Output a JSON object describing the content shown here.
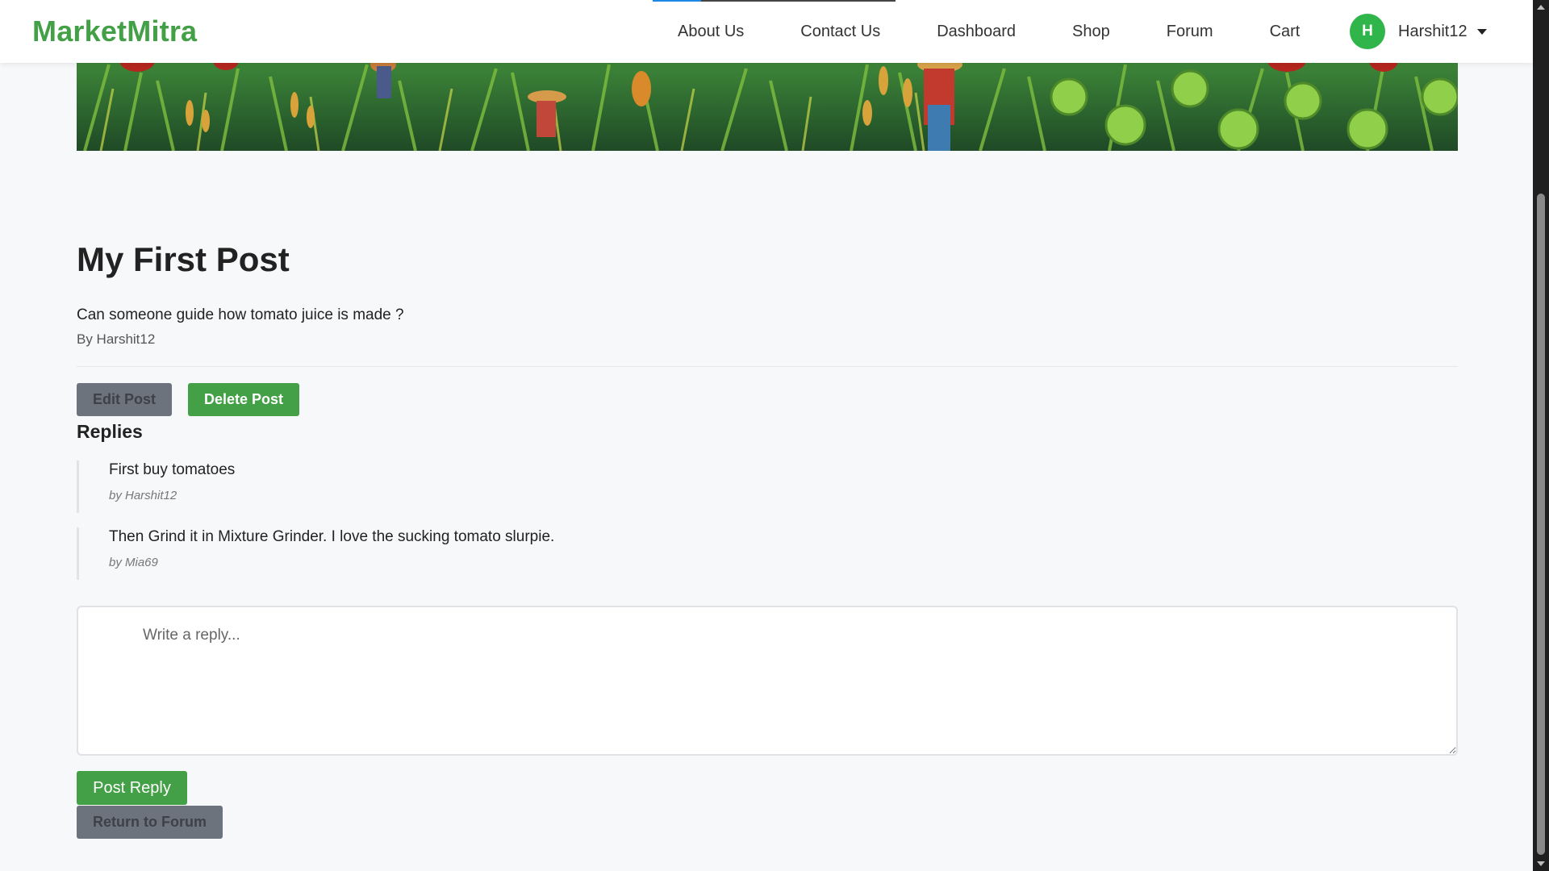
{
  "brand": {
    "name": "MarketMitra",
    "color": "#43a047"
  },
  "nav": {
    "links": [
      "About Us",
      "Contact Us",
      "Dashboard",
      "Shop",
      "Forum",
      "Cart"
    ]
  },
  "user": {
    "avatar_letter": "H",
    "name": "Harshit12"
  },
  "post": {
    "title": "My First Post",
    "body": "Can someone guide how tomato juice is made ?",
    "author": "By Harshit12"
  },
  "actions": {
    "edit_label": "Edit Post",
    "delete_label": "Delete Post"
  },
  "replies": {
    "heading": "Replies",
    "items": [
      {
        "text": "First buy tomatoes",
        "author": "by Harshit12"
      },
      {
        "text": "Then Grind it in Mixture Grinder. I love the sucking tomato slurpie.",
        "author": "by Mia69"
      }
    ]
  },
  "reply_form": {
    "placeholder": "Write a reply...",
    "value": "",
    "submit_label": "Post Reply",
    "return_label": "Return to Forum"
  },
  "colors": {
    "primary": "#43a047",
    "secondary": "#6c737c",
    "avatar": "#2fb54a"
  }
}
